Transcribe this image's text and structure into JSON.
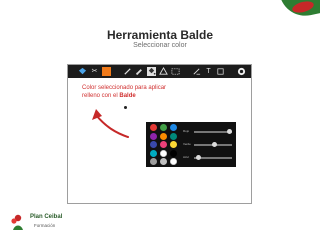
{
  "header": {
    "title": "Herramienta Balde",
    "subtitle": "Seleccionar color"
  },
  "toolbar": {
    "icons": [
      "bucket-icon",
      "scissors-icon",
      "orange-color-swatch",
      "pencil-icon",
      "brush-icon",
      "bucket-fill-icon",
      "shape-icon",
      "selection-icon",
      "eraser-icon",
      "text-icon",
      "stamp-icon",
      "record-icon"
    ],
    "active": "bucket-fill-icon",
    "accent": "#f07a1a"
  },
  "canvas": {
    "prompt_text": "Color seleccionado para aplicar relleno con el ",
    "prompt_bold": "Balde",
    "prompt_color": "#d03030"
  },
  "palette": {
    "colors": [
      "#e53935",
      "#43a047",
      "#1e88e5",
      "#8e24aa",
      "#fb8c00",
      "#00897b",
      "#3949ab",
      "#ec407a",
      "#fdd835",
      "#00acc1",
      "#ffffff",
      "#000000",
      "#9e9e9e",
      "#c0c0c0",
      "#ffffff"
    ],
    "sliders": [
      {
        "label": "Rojo",
        "value": 0.98
      },
      {
        "label": "Verde",
        "value": 0.55
      },
      {
        "label": "Azul",
        "value": 0.12
      }
    ]
  },
  "logo": {
    "name": "Plan Ceibal",
    "tagline": "Formación"
  }
}
